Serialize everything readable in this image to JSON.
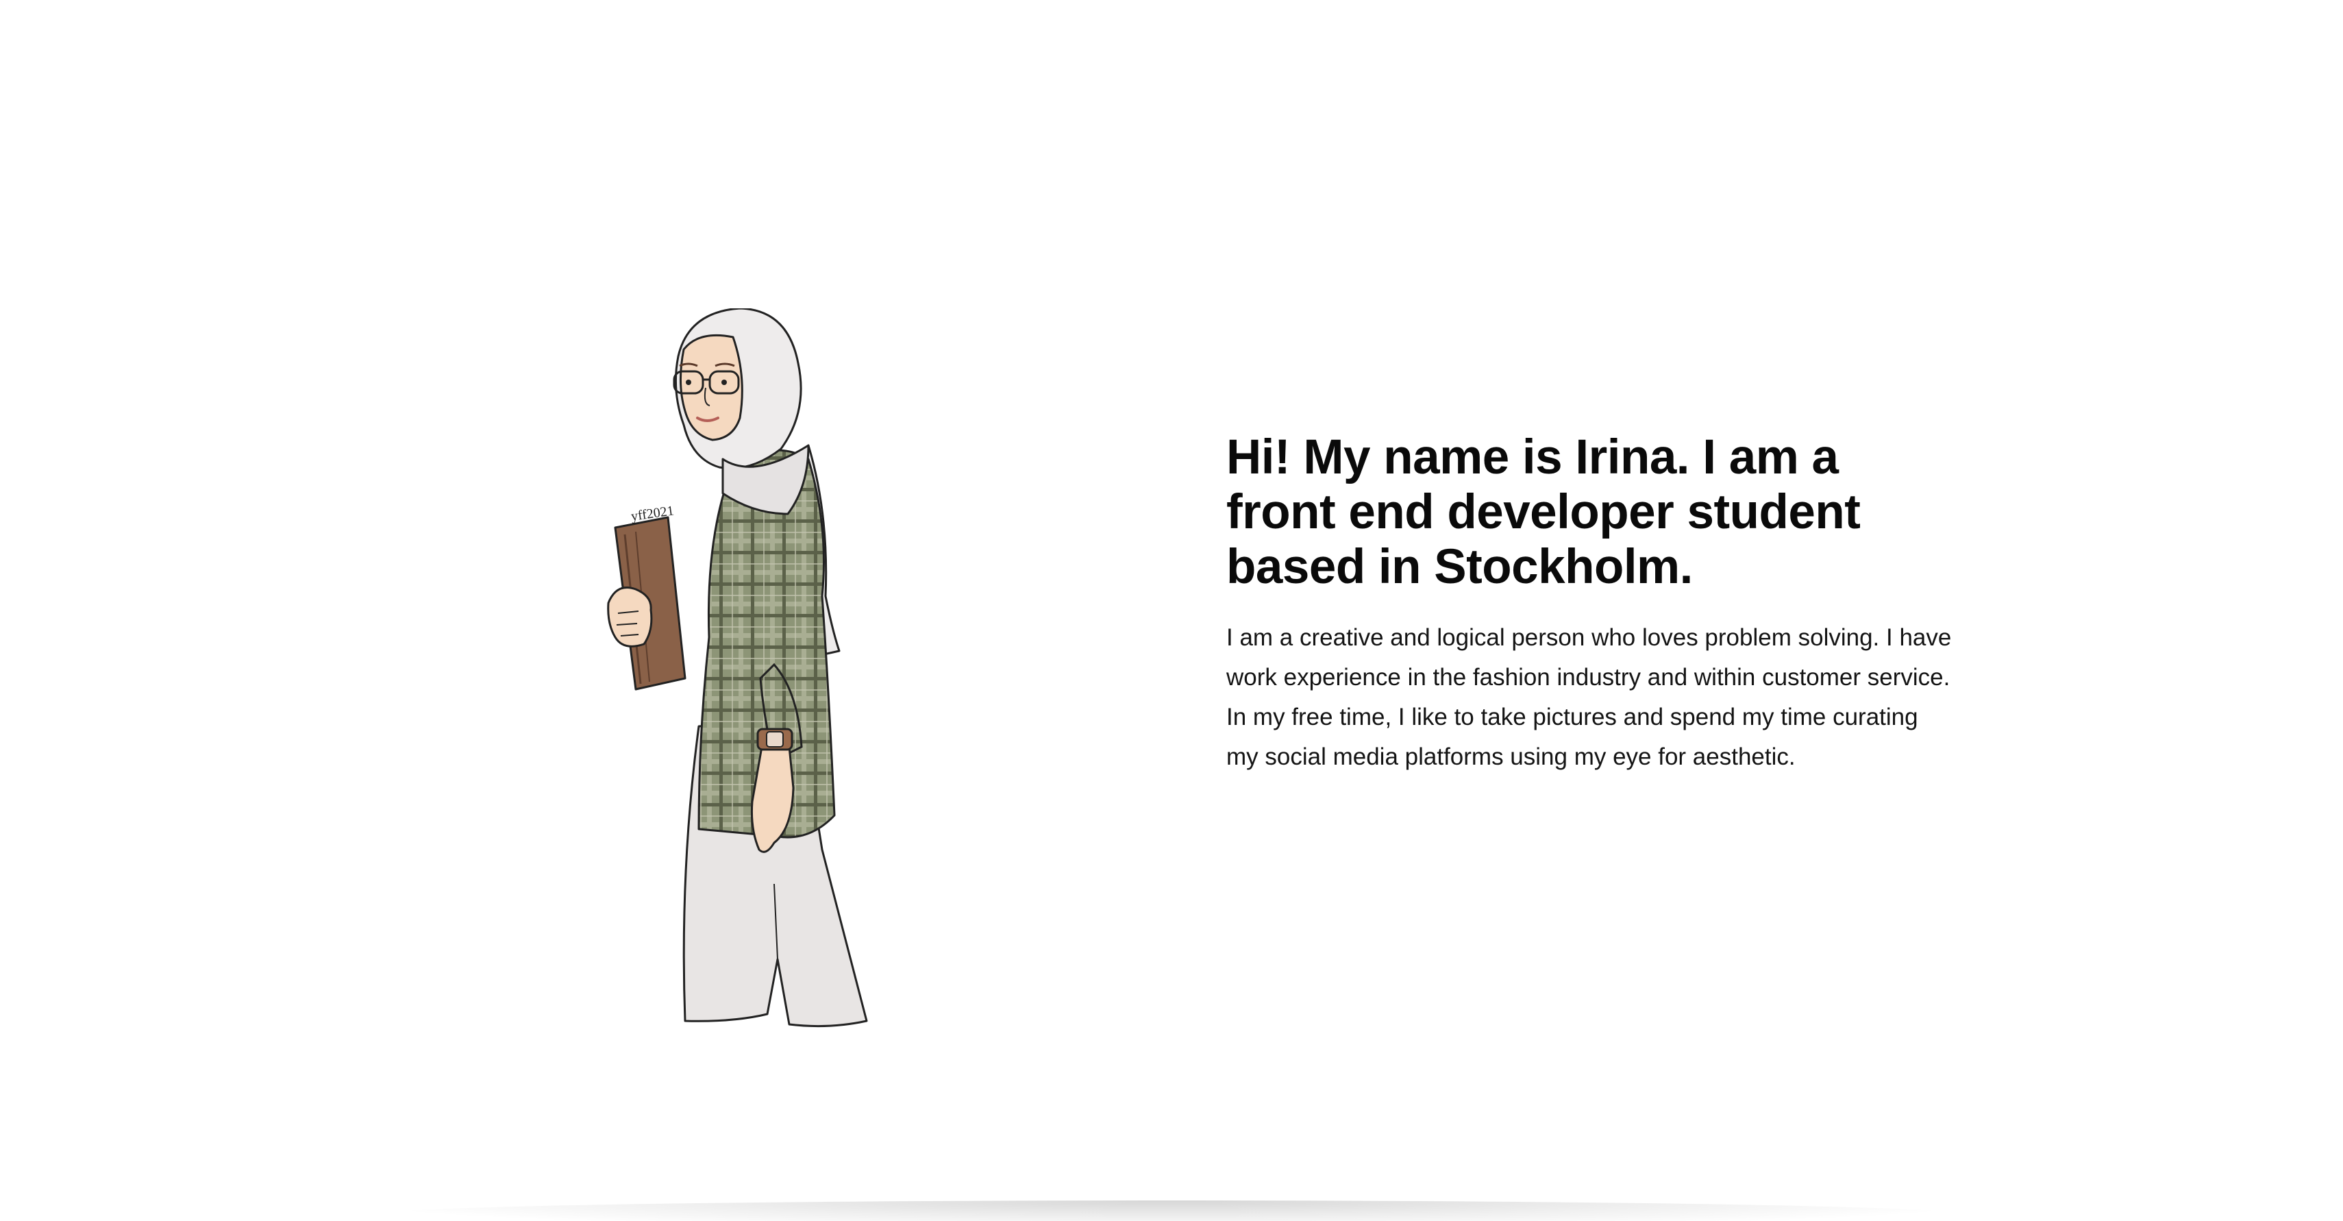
{
  "hero": {
    "heading": "Hi! My name is Irina. I am a front end developer student based in Stockholm.",
    "description": "I am a creative and logical person who loves problem solving. I have work experience in the fashion industry and within customer service. In my free time, I like to take pictures and spend my time curating my social media platforms using my eye for aesthetic.",
    "illustration": {
      "icon": "student-illustration",
      "book_text": "yff2021"
    }
  },
  "colors": {
    "background": "#ffffff",
    "text": "#0a0a0a",
    "shirt": "#8d9577",
    "hijab": "#e9e7e7",
    "book": "#8a6148"
  }
}
